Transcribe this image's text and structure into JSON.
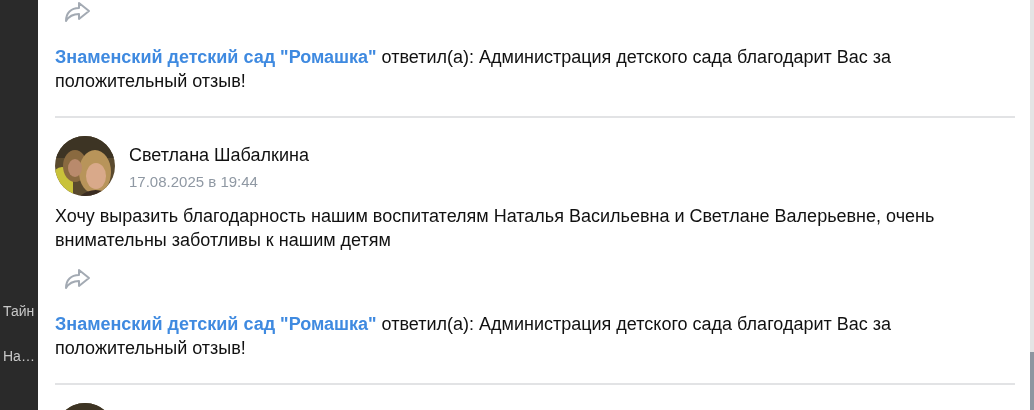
{
  "backdrop": {
    "texts": [
      "Тайн",
      "На…"
    ]
  },
  "reviews": [
    {
      "reply": {
        "author": "Знаменский детский сад \"Ромашка\"",
        "verb": "ответил(а):",
        "text": "Администрация детского сада благодарит Вас за положительный отзыв!"
      }
    },
    {
      "avatar": {
        "kind": "picture"
      },
      "author": "Светлана Шабалкина",
      "date": "17.08.2025 в 19:44",
      "text": "Хочу выразить благодарность нашим воспитателям Наталья Васильевна и Светлане Валерьевне, очень внимательны заботливы к нашим детям",
      "reply": {
        "author": "Знаменский детский сад \"Ромашка\"",
        "verb": "ответил(а):",
        "text": "Администрация детского сада благодарит Вас за положительный отзыв!"
      }
    },
    {
      "avatar": {
        "kind": "picture"
      }
    }
  ]
}
